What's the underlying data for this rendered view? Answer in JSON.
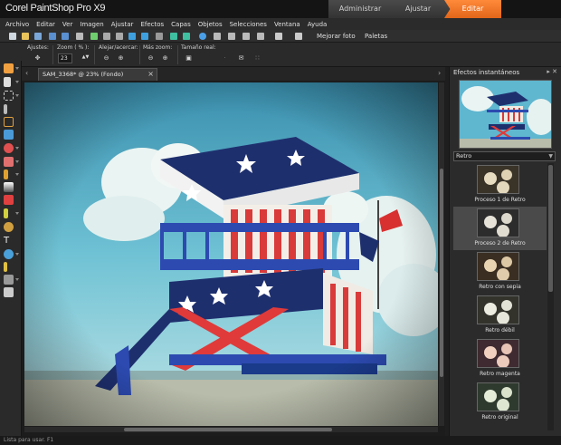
{
  "app": {
    "title": "Corel PaintShop Pro X9"
  },
  "workspace_tabs": [
    "Administrar",
    "Ajustar",
    "Editar"
  ],
  "menu": [
    "Archivo",
    "Editar",
    "Ver",
    "Imagen",
    "Ajustar",
    "Efectos",
    "Capas",
    "Objetos",
    "Selecciones",
    "Ventana",
    "Ayuda"
  ],
  "toolbar": {
    "enhance_label": "Mejorar foto",
    "palettes_label": "Paletas"
  },
  "options": {
    "presets_label": "Ajustes:",
    "zoom_label": "Zoom ( % ):",
    "zoom_value": "23",
    "zoom_inout_label": "Alejar/acercar:",
    "more_zoom_label": "Más zoom:",
    "actual_size_label": "Tamaño real:"
  },
  "document": {
    "tab_title": "SAM_3368* @  23% (Fondo)"
  },
  "panel": {
    "title": "Efectos instantáneos",
    "category": "Retro",
    "effects": [
      {
        "label": "Proceso 1 de Retro"
      },
      {
        "label": "Proceso 2 de Retro"
      },
      {
        "label": "Retro con sepia"
      },
      {
        "label": "Retro débil"
      },
      {
        "label": "Retro magenta"
      },
      {
        "label": "Retro original"
      }
    ],
    "selected_index": 1
  },
  "status": {
    "text": "Lista para usar.  F1"
  },
  "colors": {
    "accent": "#f07a2a",
    "panel_bg": "#2b2b2b",
    "sky": "#5fb6cf"
  }
}
